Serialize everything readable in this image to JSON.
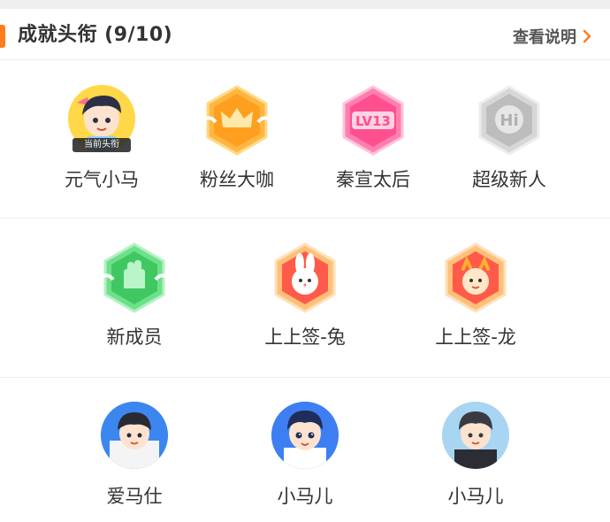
{
  "header": {
    "title": "成就头衔 (9/10)",
    "help_link": "查看说明"
  },
  "row1": [
    {
      "label": "元气小马",
      "current_tag": "当前头衔",
      "icon": "avatar-icon"
    },
    {
      "label": "粉丝大咖",
      "icon": "crown-badge-icon"
    },
    {
      "label": "秦宣太后",
      "badge_text": "LV13",
      "icon": "level-badge-icon"
    },
    {
      "label": "超级新人",
      "badge_text": "Hi",
      "icon": "hi-badge-icon"
    }
  ],
  "row2": [
    {
      "label": "新成员",
      "icon": "hand-badge-icon"
    },
    {
      "label": "上上签-兔",
      "icon": "rabbit-badge-icon"
    },
    {
      "label": "上上签-龙",
      "icon": "dragon-badge-icon"
    }
  ],
  "row3": [
    {
      "label": "爱马仕",
      "icon": "avatar-icon"
    },
    {
      "label": "小马儿",
      "icon": "avatar-icon"
    },
    {
      "label": "小马儿",
      "icon": "avatar-icon"
    }
  ],
  "colors": {
    "accent": "#ff7d1a",
    "orange_badge": "#ffa82e",
    "pink_badge": "#ff5f9d",
    "silver_badge": "#c8c8c8",
    "green_badge": "#4ccf6a"
  }
}
